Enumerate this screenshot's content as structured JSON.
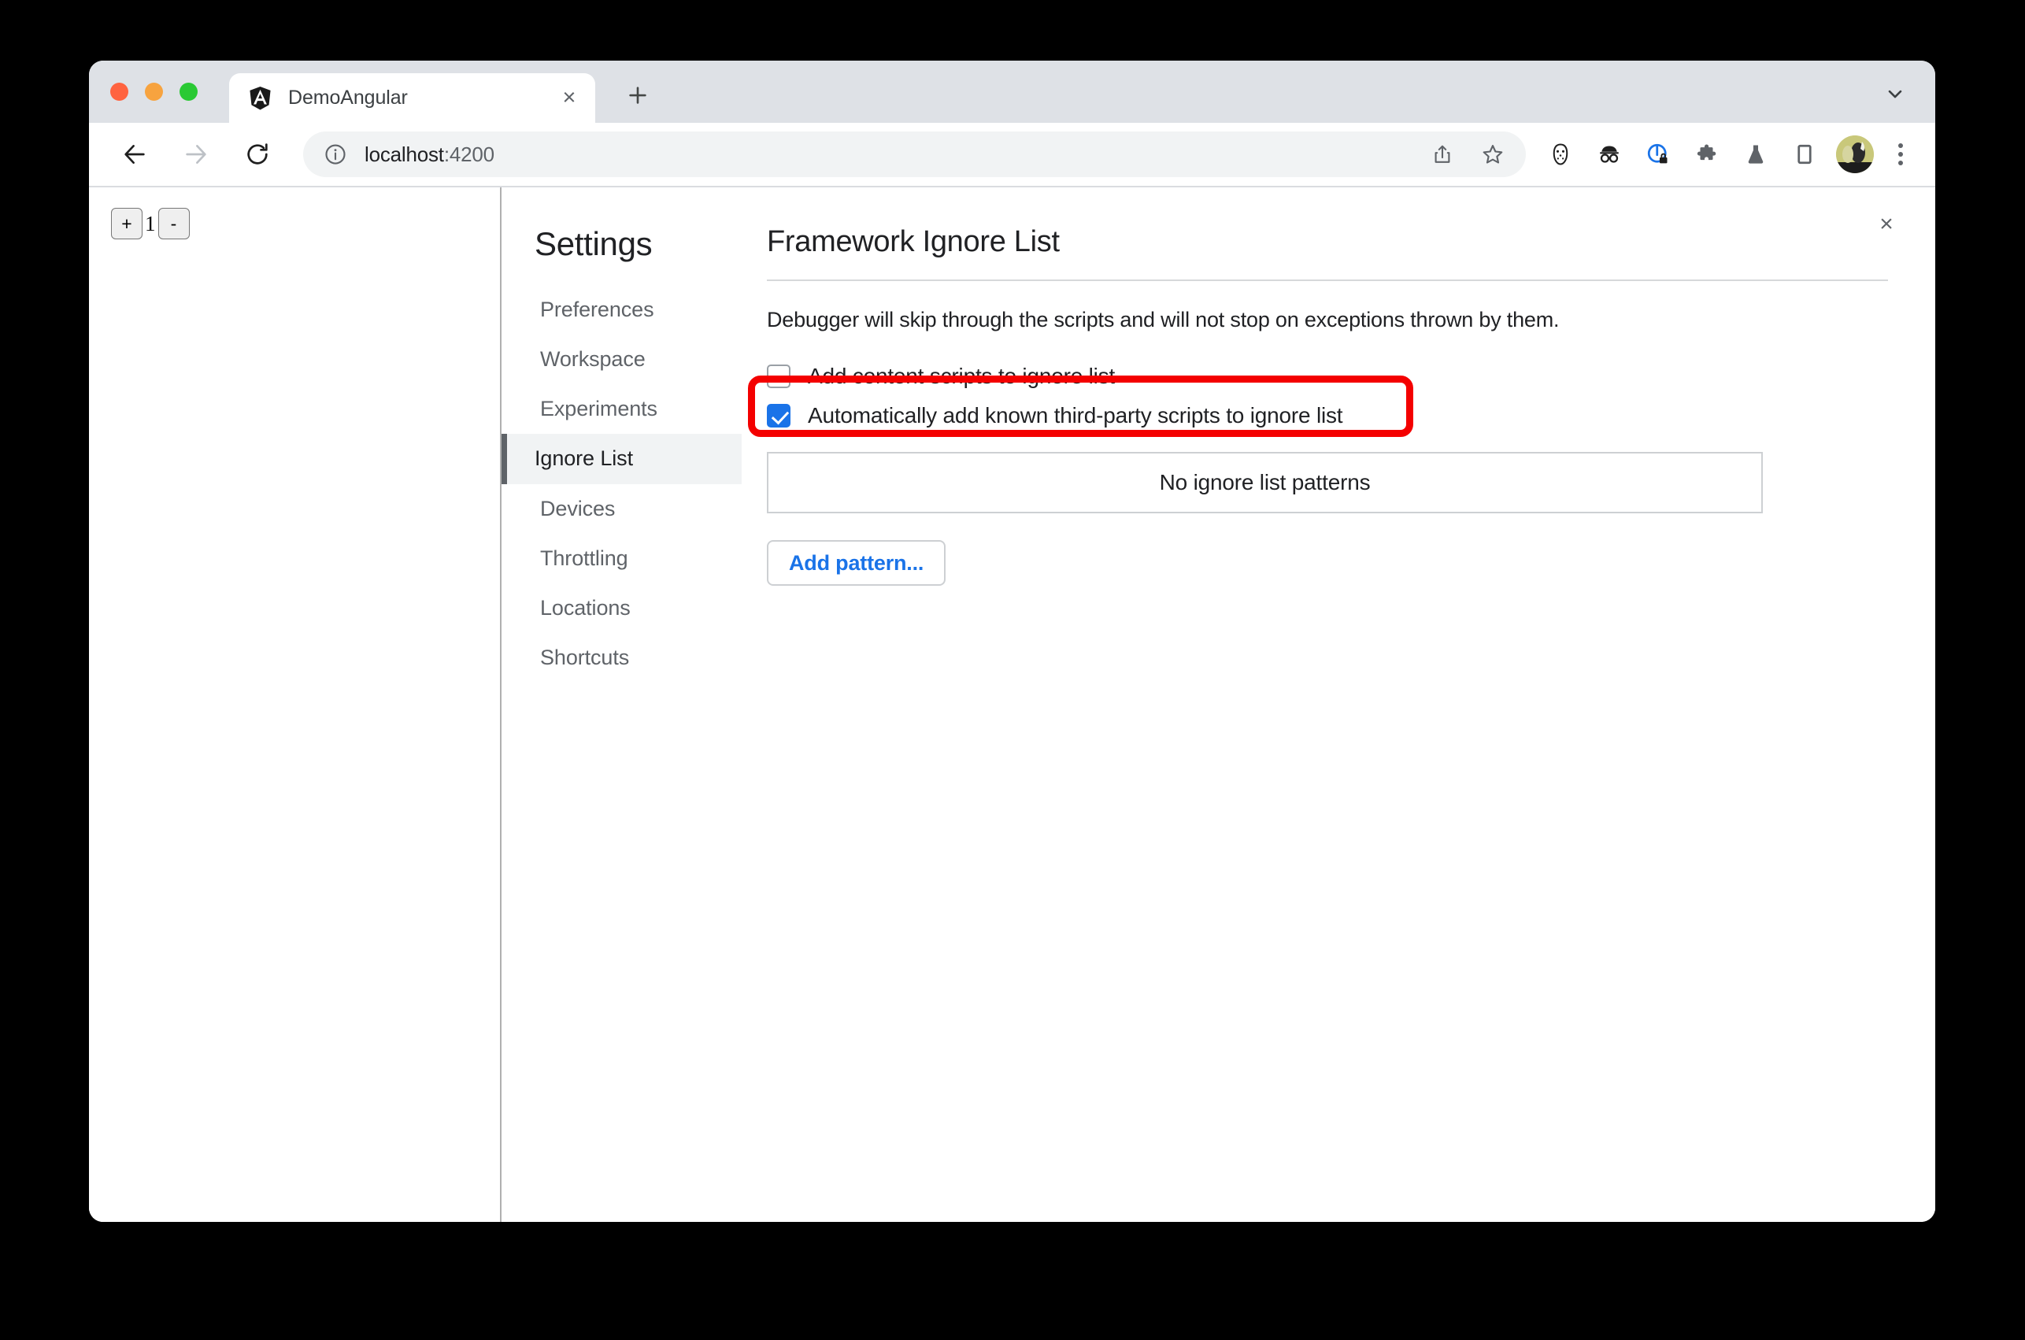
{
  "window": {
    "traffic_lights": [
      "close",
      "minimize",
      "maximize"
    ]
  },
  "tabstrip": {
    "tab": {
      "title": "DemoAngular",
      "favicon": "angular-logo-icon",
      "close_label": "×"
    },
    "new_tab_label": "+",
    "tab_list_chevron": "chevron-down-icon"
  },
  "toolbar": {
    "back": "back-arrow-icon",
    "forward": "forward-arrow-icon",
    "reload": "reload-icon",
    "site_info": "info-circle-icon",
    "url": "localhost",
    "url_port": ":4200",
    "share": "share-icon",
    "bookmark": "star-icon",
    "extensions": [
      "hockey-mask-icon",
      "incognito-glasses-icon",
      "privacy-lock-icon",
      "puzzle-piece-icon",
      "flask-icon",
      "side-panel-icon"
    ],
    "avatar": "profile-avatar",
    "menu": "three-dots-menu-icon"
  },
  "page": {
    "counter": {
      "increment_label": "+",
      "value": "1",
      "decrement_label": "-"
    }
  },
  "devtools": {
    "close_label": "×",
    "settings": {
      "title": "Settings",
      "items": [
        {
          "label": "Preferences",
          "selected": false
        },
        {
          "label": "Workspace",
          "selected": false
        },
        {
          "label": "Experiments",
          "selected": false
        },
        {
          "label": "Ignore List",
          "selected": true
        },
        {
          "label": "Devices",
          "selected": false
        },
        {
          "label": "Throttling",
          "selected": false
        },
        {
          "label": "Locations",
          "selected": false
        },
        {
          "label": "Shortcuts",
          "selected": false
        }
      ]
    },
    "panel": {
      "title": "Framework Ignore List",
      "description": "Debugger will skip through the scripts and will not stop on exceptions thrown by them.",
      "checkboxes": [
        {
          "label": "Add content scripts to ignore list",
          "checked": false
        },
        {
          "label": "Automatically add known third-party scripts to ignore list",
          "checked": true
        }
      ],
      "patterns_empty_text": "No ignore list patterns",
      "add_pattern_label": "Add pattern..."
    }
  },
  "annotation": {
    "color": "#f40000",
    "target": "Automatically add known third-party scripts to ignore list"
  }
}
